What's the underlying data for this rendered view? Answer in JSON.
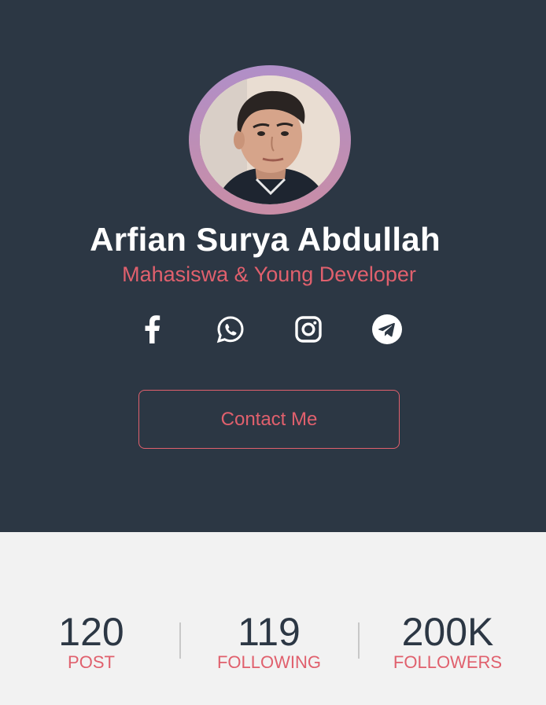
{
  "profile": {
    "name": "Arfian Surya Abdullah",
    "subtitle": "Mahasiswa & Young Developer",
    "avatar_alt": "profile photo"
  },
  "socials": [
    {
      "name": "facebook-icon"
    },
    {
      "name": "whatsapp-icon"
    },
    {
      "name": "instagram-icon"
    },
    {
      "name": "telegram-icon"
    }
  ],
  "contact": {
    "label": "Contact Me"
  },
  "stats": [
    {
      "value": "120",
      "label": "POST"
    },
    {
      "value": "119",
      "label": "FOLLOWING"
    },
    {
      "value": "200K",
      "label": "FOLLOWERS"
    }
  ],
  "colors": {
    "header_bg": "#2c3744",
    "accent": "#e0606d",
    "body_bg": "#f2f2f2",
    "ring_top": "#b08fc8",
    "ring_bottom": "#c98da6"
  }
}
